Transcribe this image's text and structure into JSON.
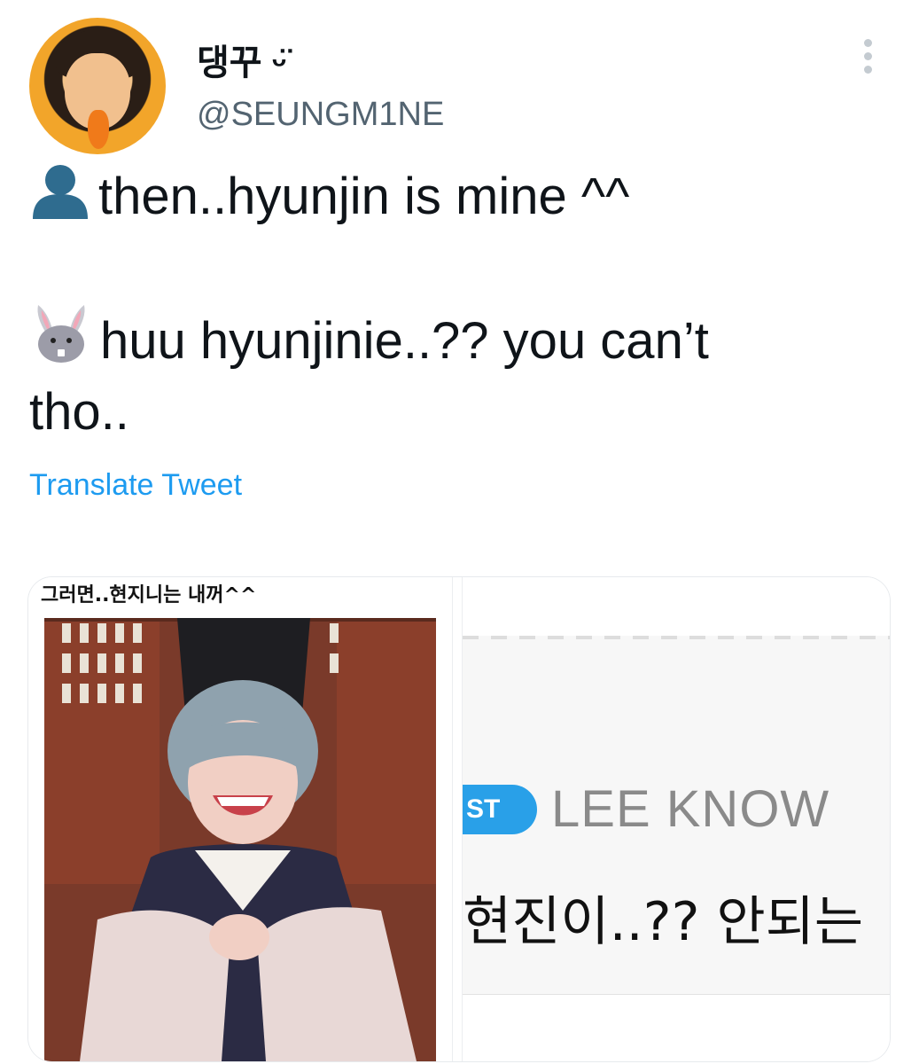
{
  "tweet": {
    "display_name": "댕꾸 ᵕ̈",
    "handle": "@SEUNGM1NE",
    "lines": [
      "then..hyunjin is mine ^^",
      "huu hyunjinie..?? you can’t",
      "tho.."
    ],
    "translate_label": "Translate Tweet"
  },
  "icons": {
    "person": "bust-in-silhouette-icon",
    "rabbit": "rabbit-face-icon",
    "more": "more-options-icon"
  },
  "media": {
    "left_caption": "그러면..현지니는 내꺼^^",
    "right_badge": "ST",
    "right_name": "LEE KNOW",
    "right_text": "현진이..?? 안되는"
  },
  "colors": {
    "link": "#1d9bf0",
    "handle": "#536471",
    "badge": "#29a0e8"
  }
}
